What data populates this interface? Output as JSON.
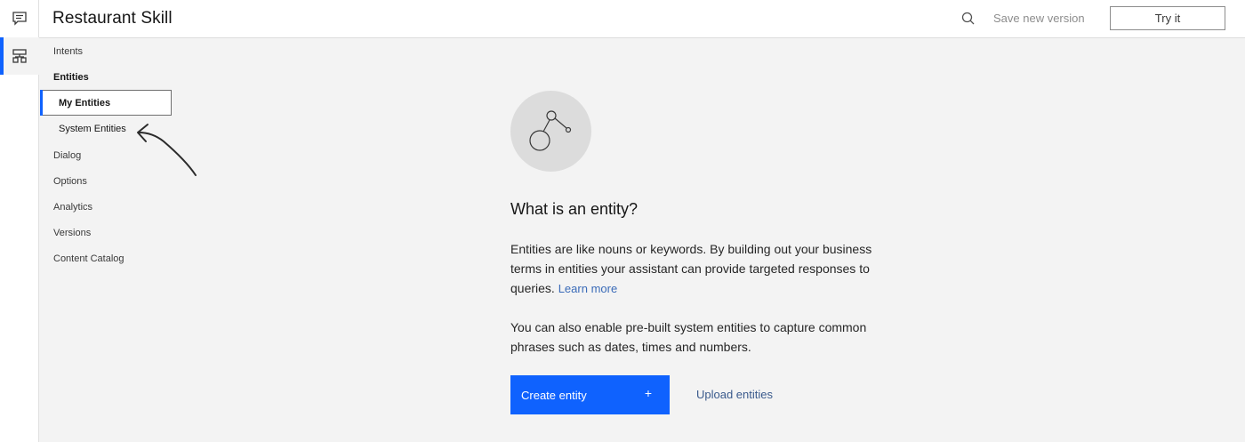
{
  "rail": {
    "items": [
      {
        "icon": "chat-icon",
        "active": false
      },
      {
        "icon": "hierarchy-icon",
        "active": true
      }
    ]
  },
  "header": {
    "title": "Restaurant Skill",
    "search_icon": "search-icon",
    "save_label": "Save new version",
    "try_label": "Try it"
  },
  "nav": {
    "intents": "Intents",
    "entities": "Entities",
    "my_entities": "My Entities",
    "system_entities": "System Entities",
    "dialog": "Dialog",
    "options": "Options",
    "analytics": "Analytics",
    "versions": "Versions",
    "content_catalog": "Content Catalog"
  },
  "main": {
    "heading": "What is an entity?",
    "para1": "Entities are like nouns or keywords. By building out your business terms in entities your assistant can provide targeted responses to queries.",
    "learn_more": "Learn more",
    "para2": "You can also enable pre-built system entities to capture common phrases such as dates, times and numbers.",
    "create_label": "Create entity",
    "create_plus": "+",
    "upload_label": "Upload entities"
  },
  "colors": {
    "accent": "#0f62fe",
    "background": "#f3f3f3",
    "link": "#3a6bb8"
  }
}
